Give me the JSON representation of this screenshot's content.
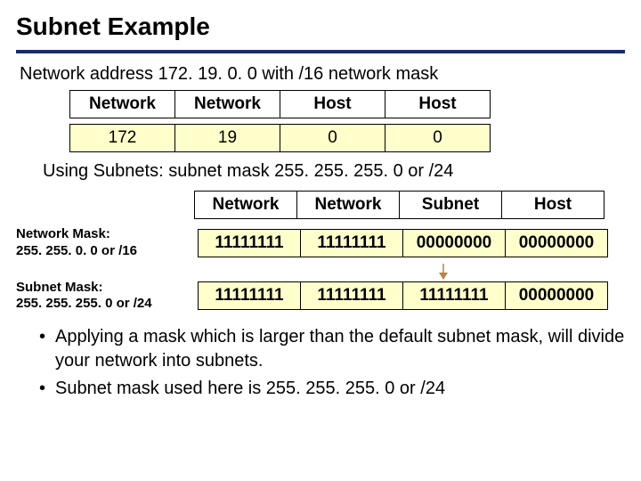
{
  "title": "Subnet Example",
  "intro": "Network address 172. 19. 0. 0 with /16 network mask",
  "table1": {
    "headers": [
      "Network",
      "Network",
      "Host",
      "Host"
    ],
    "values": [
      "172",
      "19",
      "0",
      "0"
    ]
  },
  "using_text": "Using Subnets: subnet mask 255. 255. 255. 0 or /24",
  "table2_headers": [
    "Network",
    "Network",
    "Subnet",
    "Host"
  ],
  "mask_rows": [
    {
      "label_line1": "Network Mask:",
      "label_line2": "255. 255. 0. 0 or /16",
      "cells": [
        "11111111",
        "11111111",
        "00000000",
        "00000000"
      ]
    },
    {
      "label_line1": "Subnet Mask:",
      "label_line2": "255. 255. 255. 0 or /24",
      "cells": [
        "11111111",
        "11111111",
        "11111111",
        "00000000"
      ]
    }
  ],
  "bullets": [
    "Applying a mask which is larger than the default subnet mask, will divide your network into subnets.",
    "Subnet mask used here is 255. 255. 255. 0 or /24"
  ]
}
